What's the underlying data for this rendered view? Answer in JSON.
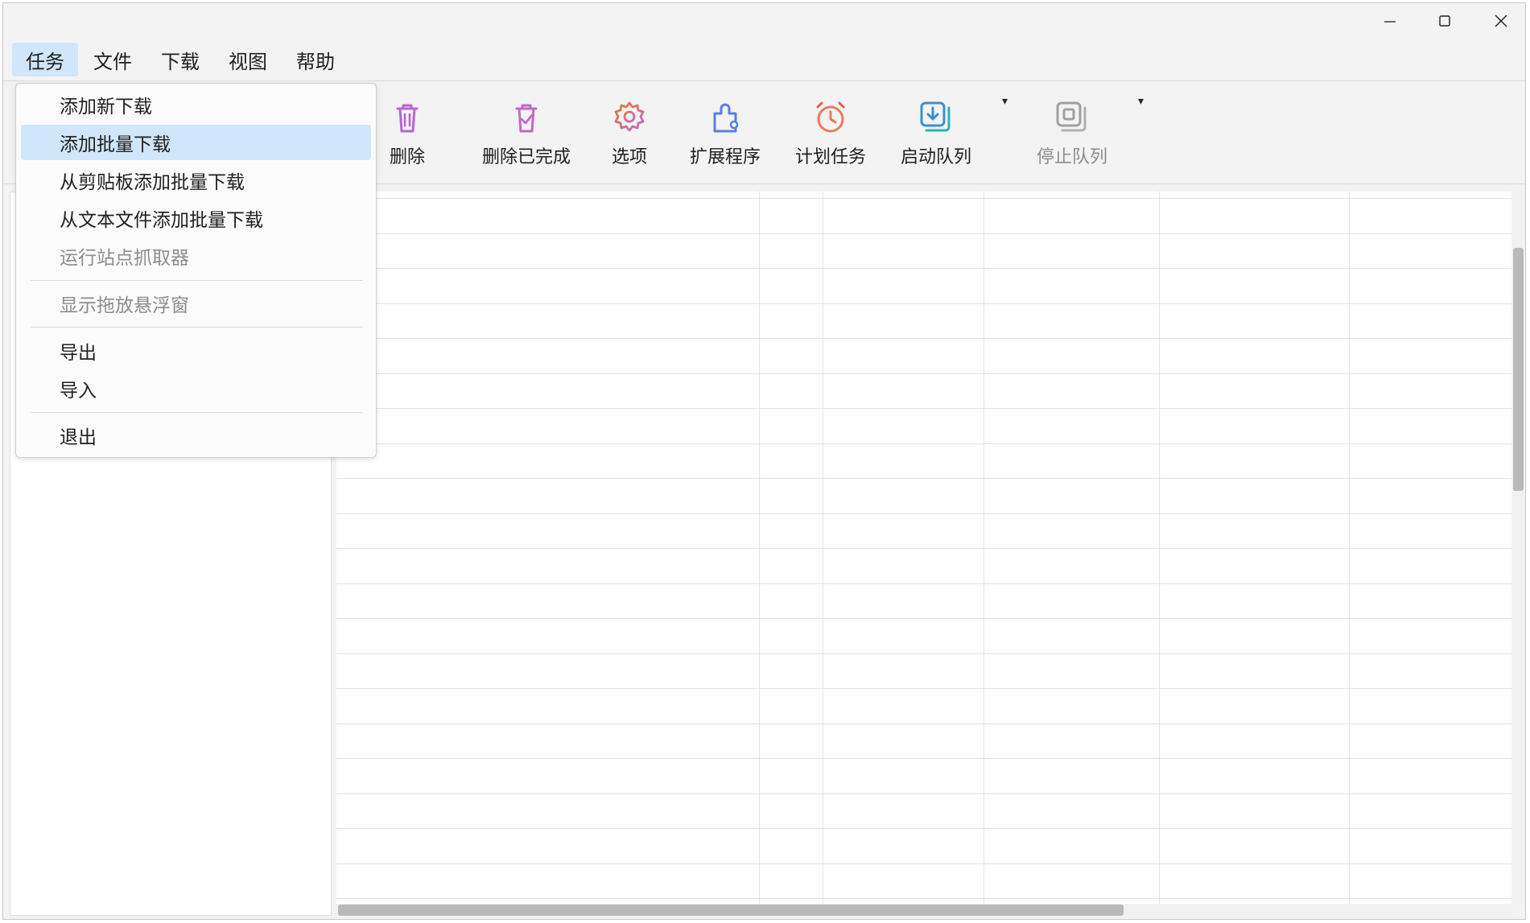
{
  "window_controls": {
    "minimize_icon": "minimize-icon",
    "maximize_icon": "maximize-icon",
    "close_icon": "close-icon"
  },
  "menubar": {
    "items": [
      {
        "label": "任务",
        "active": true
      },
      {
        "label": "文件",
        "active": false
      },
      {
        "label": "下载",
        "active": false
      },
      {
        "label": "视图",
        "active": false
      },
      {
        "label": "帮助",
        "active": false
      }
    ]
  },
  "toolbar": {
    "delete_label": "删除",
    "delete_completed_label": "删除已完成",
    "options_label": "选项",
    "extensions_label": "扩展程序",
    "scheduler_label": "计划任务",
    "start_queue_label": "启动队列",
    "stop_queue_label": "停止队列",
    "dropdown_arrow": "▾",
    "colors": {
      "delete": "#b865d0",
      "delete_completed": "#c06ac4",
      "options": "#e07a4a",
      "extensions": "#5a7fe0",
      "scheduler": "#ec7a5a",
      "start_queue": "#3a8fd0",
      "stop_queue": "#a0a0a0"
    }
  },
  "task_menu": {
    "items": [
      {
        "label": "添加新下载",
        "state": "normal"
      },
      {
        "label": "添加批量下载",
        "state": "highlight"
      },
      {
        "label": "从剪贴板添加批量下载",
        "state": "normal"
      },
      {
        "label": "从文本文件添加批量下载",
        "state": "normal"
      },
      {
        "label": "运行站点抓取器",
        "state": "disabled"
      },
      {
        "label": "显示拖放悬浮窗",
        "state": "disabled"
      },
      {
        "label": "导出",
        "state": "normal"
      },
      {
        "label": "导入",
        "state": "normal"
      },
      {
        "label": "退出",
        "state": "normal"
      }
    ]
  },
  "accent_color": "#cfe6fb"
}
